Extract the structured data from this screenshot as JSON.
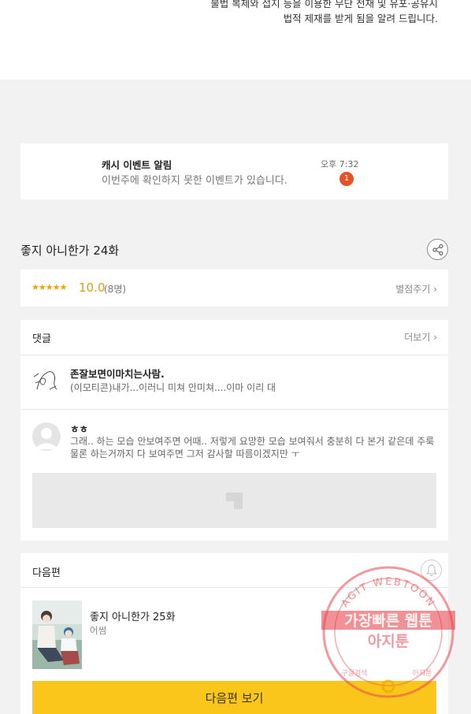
{
  "notice": {
    "line1": "불법 복제와 접지 등을 이용한 무단 전재 및 유포·공유시",
    "line2": "법적 제재를 받게 됨을 알려 드립니다."
  },
  "event": {
    "title": "캐시 이벤트 알림",
    "desc": "이번주에 확인하지 못한 이벤트가 있습니다.",
    "time": "오후 7:32",
    "badge": "1"
  },
  "episode": {
    "title": "좋지 아니한가 24화",
    "share_icon": "share-icon"
  },
  "rating": {
    "stars": "★★★★★",
    "score": "10.0",
    "count": "(8명)",
    "rate_label": "별점주기 ›"
  },
  "comments": {
    "header": "댓글",
    "more_label": "더보기 ›",
    "items": [
      {
        "name": "존잘보면이마치는사람.",
        "text": "(이모티콘)내가...이러니 미쳐 안미쳐....이마 이리 대"
      },
      {
        "name": "ㅎㅎ",
        "text": "그래.. 하는 모습 안보여주면 어때.. 저렇게 요망한 모습 보여줘서 충분히 다 본거 같은데 주룩 물론 하는거까지 다 보여주면 그저 감사할 따름이겠지만 ㅜ"
      }
    ]
  },
  "next": {
    "header": "다음편",
    "ep_title": "좋지 아니한가 25화",
    "ep_sub": "어썸",
    "button_label": "다음편 보기",
    "bell_icon": "bell-icon"
  },
  "watermark": {
    "top_text": "AGIT WEBTOON",
    "line1": "가장빠른 웹툰",
    "line2": "아지툰",
    "bottom_left": "구글검색",
    "bottom_right": "아지툰"
  },
  "colors": {
    "accent_yellow": "#fbc61c",
    "badge_red": "#e65226",
    "star_gold": "#f0a400",
    "stamp_red": "#e8464f"
  }
}
